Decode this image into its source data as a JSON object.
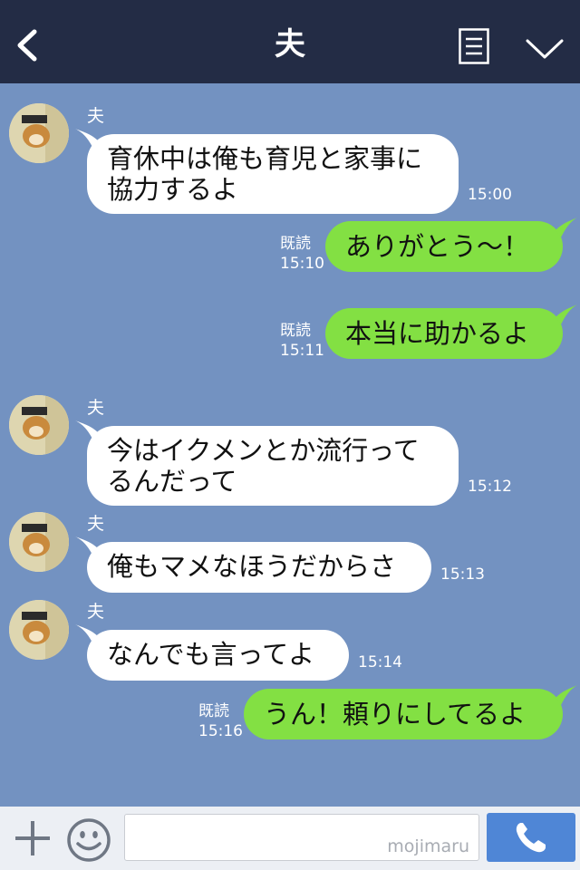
{
  "header": {
    "title": "夫",
    "back_icon": "chevron-left-icon",
    "menu_icon": "note-icon",
    "expand_icon": "chevron-down-icon"
  },
  "messages": [
    {
      "side": "in",
      "sender": "夫",
      "lines": [
        "育休中は俺も育児と家事に",
        "協力するよ"
      ],
      "time": "15:00"
    },
    {
      "side": "out",
      "read": "既読",
      "time": "15:10",
      "text": "ありがとう〜！"
    },
    {
      "side": "out",
      "read": "既読",
      "time": "15:11",
      "text": "本当に助かるよ"
    },
    {
      "side": "in",
      "sender": "夫",
      "lines": [
        "今はイクメンとか流行って",
        "るんだって"
      ],
      "time": "15:12"
    },
    {
      "side": "in",
      "sender": "夫",
      "lines": [
        "俺もマメなほうだからさ"
      ],
      "time": "15:13"
    },
    {
      "side": "in",
      "sender": "夫",
      "lines": [
        "なんでも言ってよ"
      ],
      "time": "15:14"
    },
    {
      "side": "out",
      "read": "既読",
      "time": "15:16",
      "text": "うん！頼りにしてるよ"
    }
  ],
  "footer": {
    "watermark": "mojimaru",
    "plus_icon": "plus-icon",
    "emoji_icon": "smile-icon",
    "call_icon": "phone-icon"
  },
  "colors": {
    "header_bg": "#232c45",
    "chat_bg": "#7392c1",
    "incoming_bubble": "#ffffff",
    "outgoing_bubble": "#83e043",
    "call_button": "#4f86d6"
  }
}
